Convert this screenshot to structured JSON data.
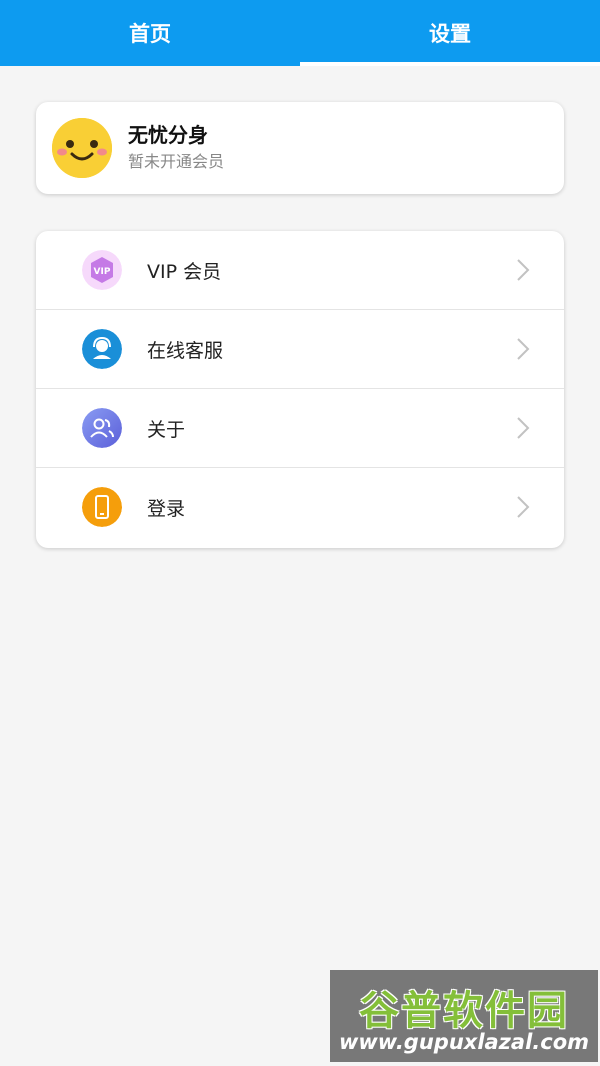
{
  "tabs": {
    "home": "首页",
    "settings": "设置"
  },
  "profile": {
    "name": "无忧分身",
    "status": "暂未开通会员",
    "avatar_icon": "smiley-face-icon"
  },
  "menu": {
    "items": [
      {
        "label": "VIP 会员",
        "icon": "vip-badge-icon",
        "color": "#d98ff0"
      },
      {
        "label": "在线客服",
        "icon": "customer-service-icon",
        "color": "#1a8fd8"
      },
      {
        "label": "关于",
        "icon": "people-icon",
        "color": "#6f72e6"
      },
      {
        "label": "登录",
        "icon": "phone-icon",
        "color": "#f59e0b"
      }
    ]
  },
  "watermark": {
    "brand": "谷普软件园",
    "url": "www.gupuxlazal.com"
  },
  "colors": {
    "accent": "#0d9bf0",
    "background": "#f5f5f5"
  }
}
